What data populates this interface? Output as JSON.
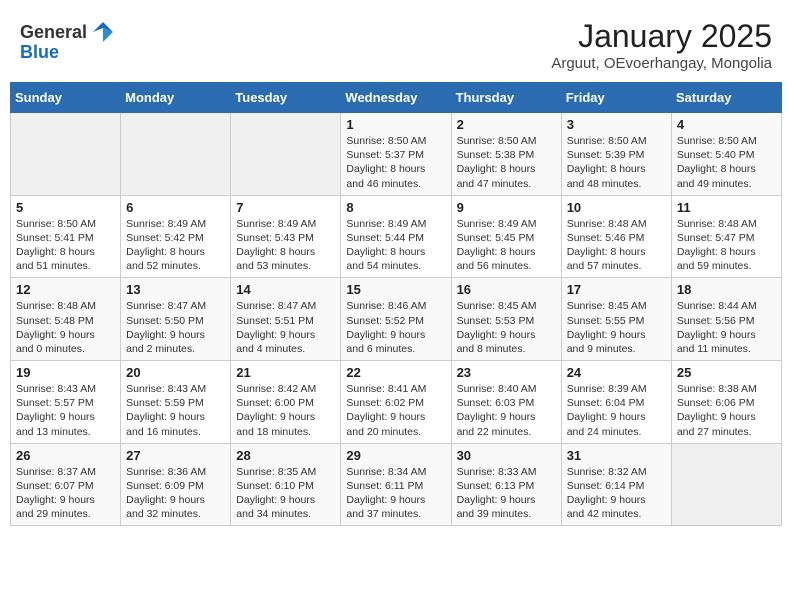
{
  "header": {
    "logo_general": "General",
    "logo_blue": "Blue",
    "month_title": "January 2025",
    "subtitle": "Arguut, OEvoerhangay, Mongolia"
  },
  "weekdays": [
    "Sunday",
    "Monday",
    "Tuesday",
    "Wednesday",
    "Thursday",
    "Friday",
    "Saturday"
  ],
  "weeks": [
    [
      {
        "day": "",
        "info": ""
      },
      {
        "day": "",
        "info": ""
      },
      {
        "day": "",
        "info": ""
      },
      {
        "day": "1",
        "info": "Sunrise: 8:50 AM\nSunset: 5:37 PM\nDaylight: 8 hours\nand 46 minutes."
      },
      {
        "day": "2",
        "info": "Sunrise: 8:50 AM\nSunset: 5:38 PM\nDaylight: 8 hours\nand 47 minutes."
      },
      {
        "day": "3",
        "info": "Sunrise: 8:50 AM\nSunset: 5:39 PM\nDaylight: 8 hours\nand 48 minutes."
      },
      {
        "day": "4",
        "info": "Sunrise: 8:50 AM\nSunset: 5:40 PM\nDaylight: 8 hours\nand 49 minutes."
      }
    ],
    [
      {
        "day": "5",
        "info": "Sunrise: 8:50 AM\nSunset: 5:41 PM\nDaylight: 8 hours\nand 51 minutes."
      },
      {
        "day": "6",
        "info": "Sunrise: 8:49 AM\nSunset: 5:42 PM\nDaylight: 8 hours\nand 52 minutes."
      },
      {
        "day": "7",
        "info": "Sunrise: 8:49 AM\nSunset: 5:43 PM\nDaylight: 8 hours\nand 53 minutes."
      },
      {
        "day": "8",
        "info": "Sunrise: 8:49 AM\nSunset: 5:44 PM\nDaylight: 8 hours\nand 54 minutes."
      },
      {
        "day": "9",
        "info": "Sunrise: 8:49 AM\nSunset: 5:45 PM\nDaylight: 8 hours\nand 56 minutes."
      },
      {
        "day": "10",
        "info": "Sunrise: 8:48 AM\nSunset: 5:46 PM\nDaylight: 8 hours\nand 57 minutes."
      },
      {
        "day": "11",
        "info": "Sunrise: 8:48 AM\nSunset: 5:47 PM\nDaylight: 8 hours\nand 59 minutes."
      }
    ],
    [
      {
        "day": "12",
        "info": "Sunrise: 8:48 AM\nSunset: 5:48 PM\nDaylight: 9 hours\nand 0 minutes."
      },
      {
        "day": "13",
        "info": "Sunrise: 8:47 AM\nSunset: 5:50 PM\nDaylight: 9 hours\nand 2 minutes."
      },
      {
        "day": "14",
        "info": "Sunrise: 8:47 AM\nSunset: 5:51 PM\nDaylight: 9 hours\nand 4 minutes."
      },
      {
        "day": "15",
        "info": "Sunrise: 8:46 AM\nSunset: 5:52 PM\nDaylight: 9 hours\nand 6 minutes."
      },
      {
        "day": "16",
        "info": "Sunrise: 8:45 AM\nSunset: 5:53 PM\nDaylight: 9 hours\nand 8 minutes."
      },
      {
        "day": "17",
        "info": "Sunrise: 8:45 AM\nSunset: 5:55 PM\nDaylight: 9 hours\nand 9 minutes."
      },
      {
        "day": "18",
        "info": "Sunrise: 8:44 AM\nSunset: 5:56 PM\nDaylight: 9 hours\nand 11 minutes."
      }
    ],
    [
      {
        "day": "19",
        "info": "Sunrise: 8:43 AM\nSunset: 5:57 PM\nDaylight: 9 hours\nand 13 minutes."
      },
      {
        "day": "20",
        "info": "Sunrise: 8:43 AM\nSunset: 5:59 PM\nDaylight: 9 hours\nand 16 minutes."
      },
      {
        "day": "21",
        "info": "Sunrise: 8:42 AM\nSunset: 6:00 PM\nDaylight: 9 hours\nand 18 minutes."
      },
      {
        "day": "22",
        "info": "Sunrise: 8:41 AM\nSunset: 6:02 PM\nDaylight: 9 hours\nand 20 minutes."
      },
      {
        "day": "23",
        "info": "Sunrise: 8:40 AM\nSunset: 6:03 PM\nDaylight: 9 hours\nand 22 minutes."
      },
      {
        "day": "24",
        "info": "Sunrise: 8:39 AM\nSunset: 6:04 PM\nDaylight: 9 hours\nand 24 minutes."
      },
      {
        "day": "25",
        "info": "Sunrise: 8:38 AM\nSunset: 6:06 PM\nDaylight: 9 hours\nand 27 minutes."
      }
    ],
    [
      {
        "day": "26",
        "info": "Sunrise: 8:37 AM\nSunset: 6:07 PM\nDaylight: 9 hours\nand 29 minutes."
      },
      {
        "day": "27",
        "info": "Sunrise: 8:36 AM\nSunset: 6:09 PM\nDaylight: 9 hours\nand 32 minutes."
      },
      {
        "day": "28",
        "info": "Sunrise: 8:35 AM\nSunset: 6:10 PM\nDaylight: 9 hours\nand 34 minutes."
      },
      {
        "day": "29",
        "info": "Sunrise: 8:34 AM\nSunset: 6:11 PM\nDaylight: 9 hours\nand 37 minutes."
      },
      {
        "day": "30",
        "info": "Sunrise: 8:33 AM\nSunset: 6:13 PM\nDaylight: 9 hours\nand 39 minutes."
      },
      {
        "day": "31",
        "info": "Sunrise: 8:32 AM\nSunset: 6:14 PM\nDaylight: 9 hours\nand 42 minutes."
      },
      {
        "day": "",
        "info": ""
      }
    ]
  ]
}
